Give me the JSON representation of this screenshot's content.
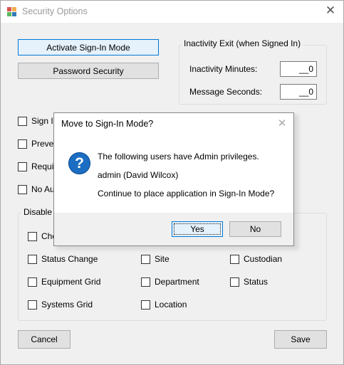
{
  "window": {
    "title": "Security Options",
    "close_glyph": "✕"
  },
  "buttons": {
    "activate": "Activate Sign-In Mode",
    "password": "Password Security",
    "cancel": "Cancel",
    "save": "Save"
  },
  "inactivity": {
    "group_title": "Inactivity Exit (when Signed In)",
    "minutes_label": "Inactivity Minutes:",
    "minutes_value": "__0",
    "seconds_label": "Message Seconds:",
    "seconds_value": "__0"
  },
  "options_partial": [
    {
      "label": "Sign In"
    },
    {
      "label": "Preven"
    },
    {
      "label": "Requir"
    },
    {
      "label": "No Aut"
    }
  ],
  "disable": {
    "group_title_partial": "Disable T",
    "items": [
      {
        "label": "Che"
      },
      {
        "label": "Status Change"
      },
      {
        "label": "Site"
      },
      {
        "label": "Custodian"
      },
      {
        "label": "Equipment Grid"
      },
      {
        "label": "Department"
      },
      {
        "label": "Status"
      },
      {
        "label": "Systems Grid"
      },
      {
        "label": "Location"
      }
    ]
  },
  "dialog": {
    "title": "Move to Sign-In Mode?",
    "close_glyph": "✕",
    "icon_glyph": "?",
    "line1": "The following users have Admin privileges.",
    "line2": "admin (David Wilcox)",
    "line3": "Continue to place application in Sign-In Mode?",
    "yes": "Yes",
    "no": "No"
  },
  "icons": {
    "app": "app-icon",
    "question": "question-icon"
  }
}
